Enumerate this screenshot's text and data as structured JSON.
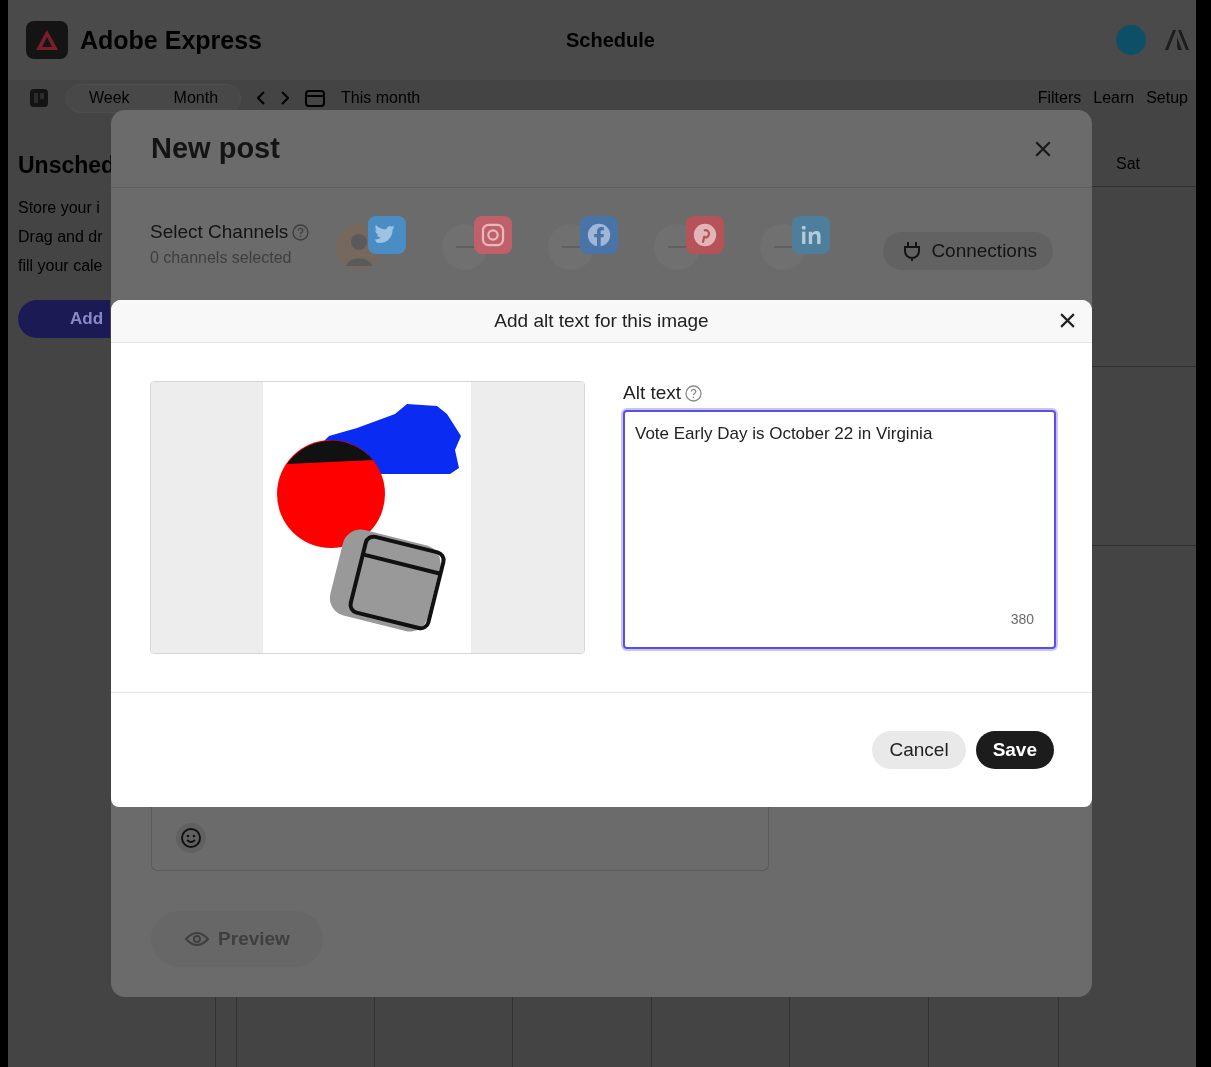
{
  "app": {
    "title": "Adobe Express",
    "page_title": "Schedule"
  },
  "toolbar": {
    "views": [
      "Week",
      "Month"
    ],
    "range": "This month",
    "actions": [
      "Filters",
      "Learn",
      "Setup"
    ]
  },
  "unscheduled": {
    "title": "Unsched",
    "lines": [
      "Store your i",
      "Drag and dr",
      "fill your cale"
    ],
    "button": "Add"
  },
  "calendar": {
    "day_header": "Sat"
  },
  "new_post": {
    "title": "New post",
    "select_channels": "Select Channels",
    "channels_selected": "0 channels selected",
    "channels": [
      {
        "kind": "twitter",
        "connected": true,
        "color": "#4a8cc4"
      },
      {
        "kind": "instagram",
        "connected": false,
        "color": "#c0606a"
      },
      {
        "kind": "facebook",
        "connected": false,
        "color": "#4a73a8"
      },
      {
        "kind": "pinterest",
        "connected": false,
        "color": "#b55358"
      },
      {
        "kind": "linkedin",
        "connected": false,
        "color": "#4d7f9d"
      }
    ],
    "connections_button": "Connections",
    "preview_button": "Preview"
  },
  "alt_dialog": {
    "title": "Add alt text for this image",
    "label": "Alt text",
    "value": "Vote Early Day is October 22 in Virginia",
    "counter": "380",
    "buttons": [
      {
        "label": "Cancel",
        "kind": "secondary"
      },
      {
        "label": "Save",
        "kind": "primary"
      }
    ]
  }
}
